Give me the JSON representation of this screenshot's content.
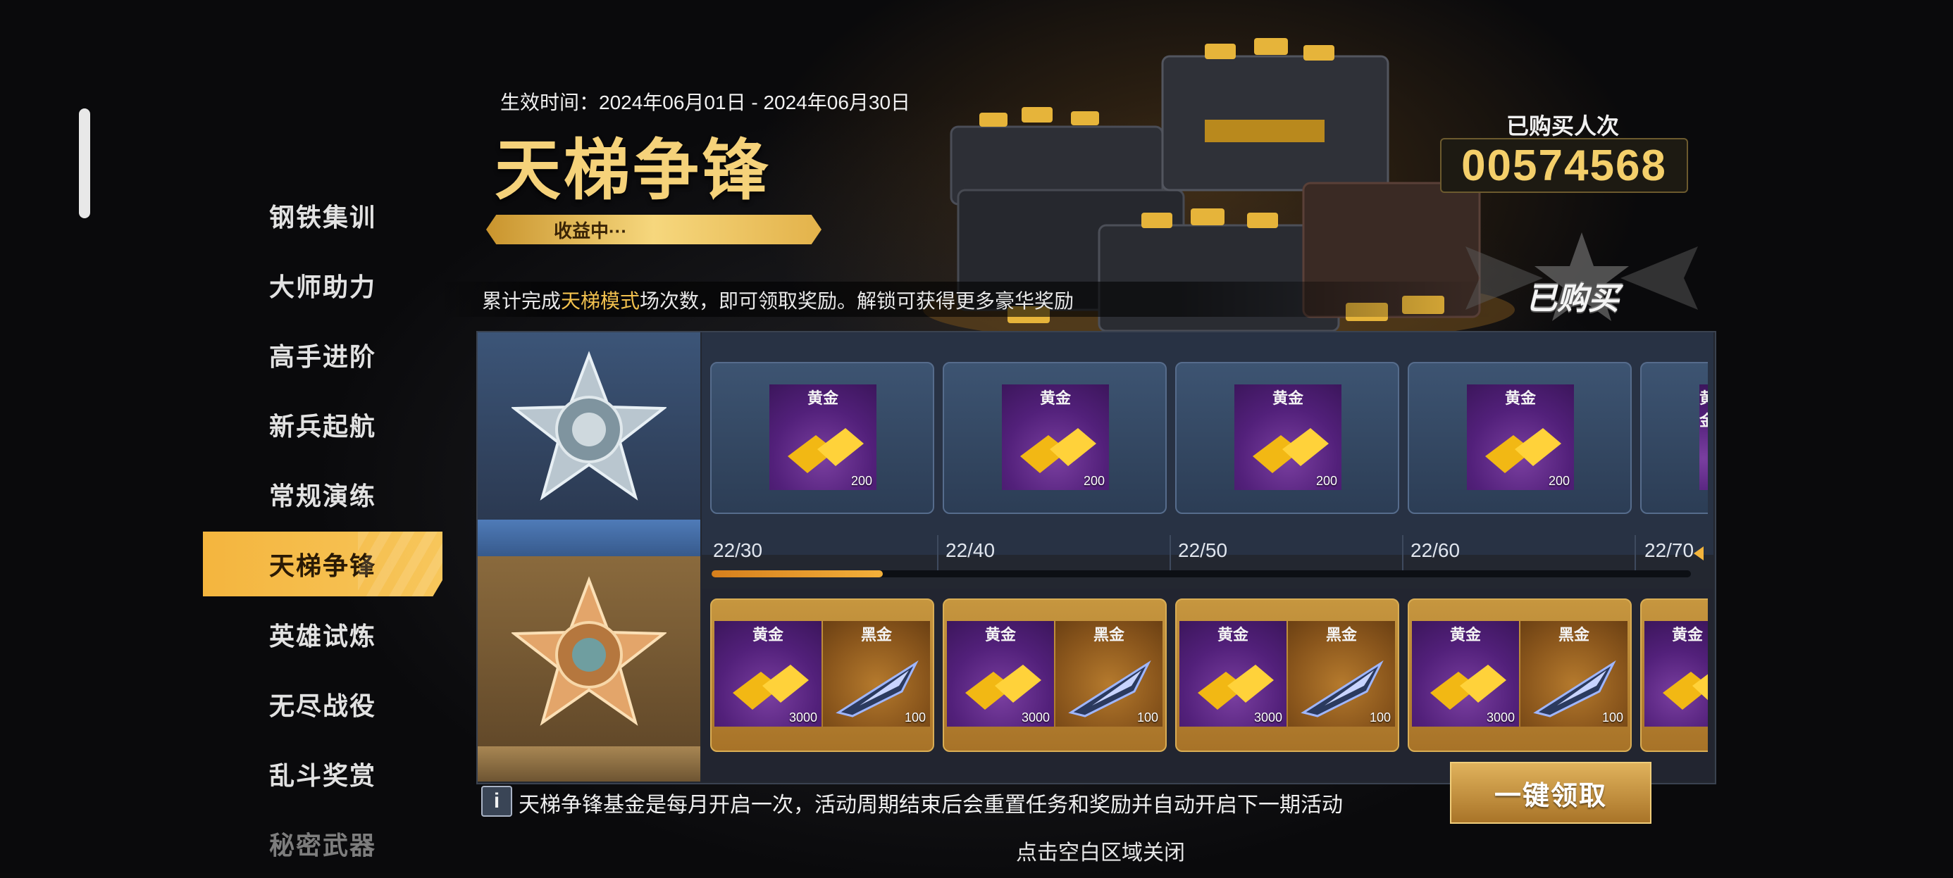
{
  "sidebar": {
    "items": [
      {
        "label": "钢铁集训"
      },
      {
        "label": "大师助力"
      },
      {
        "label": "高手进阶"
      },
      {
        "label": "新兵起航"
      },
      {
        "label": "常规演练"
      },
      {
        "label": "天梯争锋",
        "active": true
      },
      {
        "label": "英雄试炼"
      },
      {
        "label": "无尽战役"
      },
      {
        "label": "乱斗奖赏"
      },
      {
        "label": "秘密武器"
      }
    ]
  },
  "header": {
    "validity": "生效时间：2024年06月01日 - 2024年06月30日",
    "title": "天梯争锋",
    "status": "收益中···",
    "desc_prefix": "累计完成",
    "desc_highlight": "天梯模式",
    "desc_suffix": "场次数，即可领取奖励。解锁可获得更多豪华奖励"
  },
  "purchase": {
    "label": "已购买人次",
    "count": "00574568",
    "badge": "已购买"
  },
  "progress": {
    "milestones": [
      "22/30",
      "22/40",
      "22/50",
      "22/60",
      "22/70"
    ],
    "current": 22,
    "fill_fraction": 0.175
  },
  "rewards": {
    "free": [
      {
        "label": "黄金",
        "qty": "200"
      },
      {
        "label": "黄金",
        "qty": "200"
      },
      {
        "label": "黄金",
        "qty": "200"
      },
      {
        "label": "黄金",
        "qty": "200"
      },
      {
        "label": "黄金",
        "qty": ""
      }
    ],
    "premium": [
      {
        "gold_label": "黄金",
        "gold_qty": "3000",
        "black_label": "黑金",
        "black_qty": "100"
      },
      {
        "gold_label": "黄金",
        "gold_qty": "3000",
        "black_label": "黑金",
        "black_qty": "100"
      },
      {
        "gold_label": "黄金",
        "gold_qty": "3000",
        "black_label": "黑金",
        "black_qty": "100"
      },
      {
        "gold_label": "黄金",
        "gold_qty": "3000",
        "black_label": "黑金",
        "black_qty": "100"
      },
      {
        "gold_label": "黄金",
        "gold_qty": "",
        "black_label": "",
        "black_qty": ""
      }
    ]
  },
  "footer": {
    "info_icon": "i",
    "note": "天梯争锋基金是每月开启一次，活动周期结束后会重置任务和奖励并自动开启下一期活动",
    "claim_button": "一键领取",
    "close_hint": "点击空白区域关闭"
  },
  "colors": {
    "accent_gold": "#f4cf6a",
    "highlight": "#f2c14e",
    "progress": "#f3b03a"
  }
}
